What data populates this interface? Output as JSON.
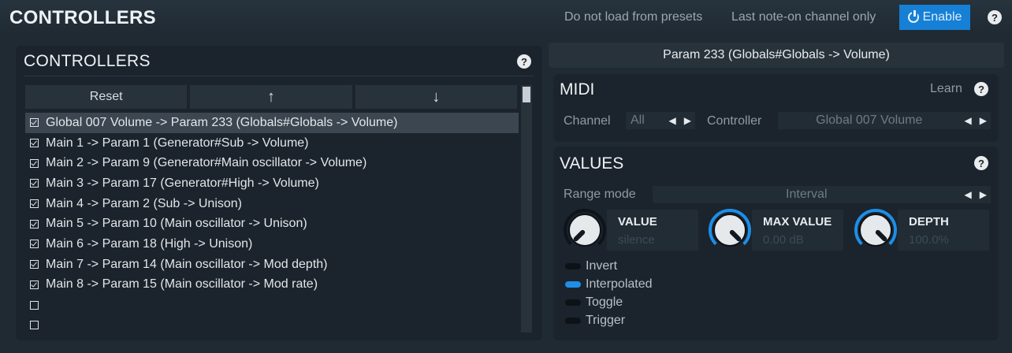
{
  "window": {
    "title": "CONTROLLERS",
    "opt_presets": "Do not load from presets",
    "opt_channel": "Last note-on channel only",
    "enable_label": "Enable",
    "help_label": "?"
  },
  "controllers_panel": {
    "title": "CONTROLLERS",
    "help_label": "?",
    "reset_label": "Reset",
    "up_label": "↑",
    "down_label": "↓",
    "items": [
      {
        "label": "Global 007 Volume -> Param 233 (Globals#Globals -> Volume)",
        "checked": true,
        "selected": true
      },
      {
        "label": "Main 1 -> Param 1 (Generator#Sub -> Volume)",
        "checked": true
      },
      {
        "label": "Main 2 -> Param 9 (Generator#Main oscillator -> Volume)",
        "checked": true
      },
      {
        "label": "Main 3 -> Param 17 (Generator#High -> Volume)",
        "checked": true
      },
      {
        "label": "Main 4 -> Param 2 (Sub -> Unison)",
        "checked": true
      },
      {
        "label": "Main 5 -> Param 10 (Main oscillator -> Unison)",
        "checked": true
      },
      {
        "label": "Main 6 -> Param 18 (High -> Unison)",
        "checked": true
      },
      {
        "label": "Main 7 -> Param 14 (Main oscillator -> Mod depth)",
        "checked": true
      },
      {
        "label": "Main 8 -> Param 15 (Main oscillator -> Mod rate)",
        "checked": true
      },
      {
        "label": "",
        "checked": false
      },
      {
        "label": "",
        "checked": false
      }
    ]
  },
  "param_header": "Param 233 (Globals#Globals -> Volume)",
  "midi": {
    "title": "MIDI",
    "learn_label": "Learn",
    "help_label": "?",
    "channel_label": "Channel",
    "channel_value": "All",
    "controller_label": "Controller",
    "controller_value": "Global 007 Volume"
  },
  "values": {
    "title": "VALUES",
    "help_label": "?",
    "range_mode_label": "Range mode",
    "range_mode_value": "Interval",
    "knobs": [
      {
        "name": "VALUE",
        "value": "silence",
        "level": 0.0
      },
      {
        "name": "MAX VALUE",
        "value": "0.00 dB",
        "level": 1.0
      },
      {
        "name": "DEPTH",
        "value": "100.0%",
        "level": 1.0
      }
    ],
    "toggles": [
      {
        "label": "Invert",
        "on": false
      },
      {
        "label": "Interpolated",
        "on": true
      },
      {
        "label": "Toggle",
        "on": false
      },
      {
        "label": "Trigger",
        "on": false
      }
    ]
  },
  "colors": {
    "accent": "#1e8ee8",
    "background": "#1f2a33",
    "panel": "#1b242c"
  }
}
